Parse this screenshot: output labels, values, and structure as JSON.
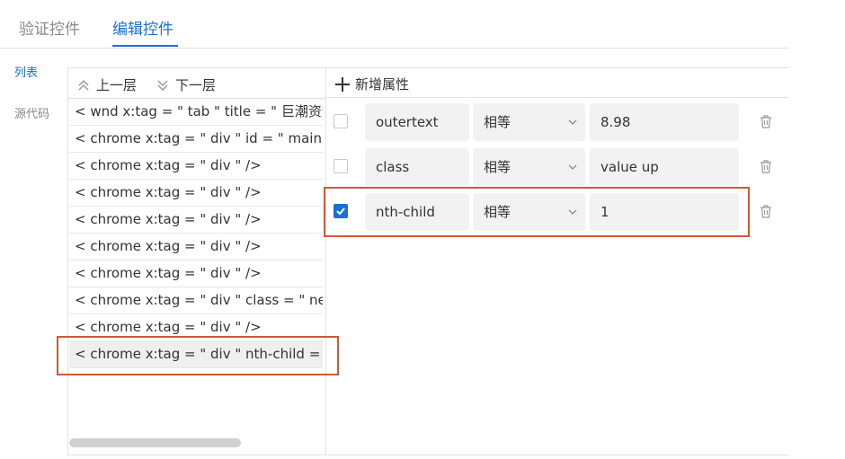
{
  "tabs": {
    "validate": "验证控件",
    "edit": "编辑控件"
  },
  "side": {
    "list": "列表",
    "source": "源代码"
  },
  "nav": {
    "up": "上一层",
    "down": "下一层"
  },
  "tree_rows": [
    "< wnd  x:tag = \" tab \"  title = \" 巨潮资讯",
    "< chrome  x:tag = \" div \"  id = \" main \"",
    "< chrome  x:tag = \" div \" />",
    "< chrome  x:tag = \" div \" />",
    "< chrome  x:tag = \" div \" />",
    "< chrome  x:tag = \" div \" />",
    "< chrome  x:tag = \" div \" />",
    "< chrome  x:tag = \" div \"  class = \" new",
    "< chrome  x:tag = \" div \" />",
    "< chrome  x:tag = \" div \"  nth-child = \""
  ],
  "add_attribute": "新增属性",
  "attributes": [
    {
      "checked": false,
      "name": "outertext",
      "op": "相等",
      "value": "8.98"
    },
    {
      "checked": false,
      "name": "class",
      "op": "相等",
      "value": "value up"
    },
    {
      "checked": true,
      "name": "nth-child",
      "op": "相等",
      "value": "1"
    }
  ],
  "colors": {
    "accent": "#1a6fd8",
    "highlight": "#cc5a35"
  }
}
